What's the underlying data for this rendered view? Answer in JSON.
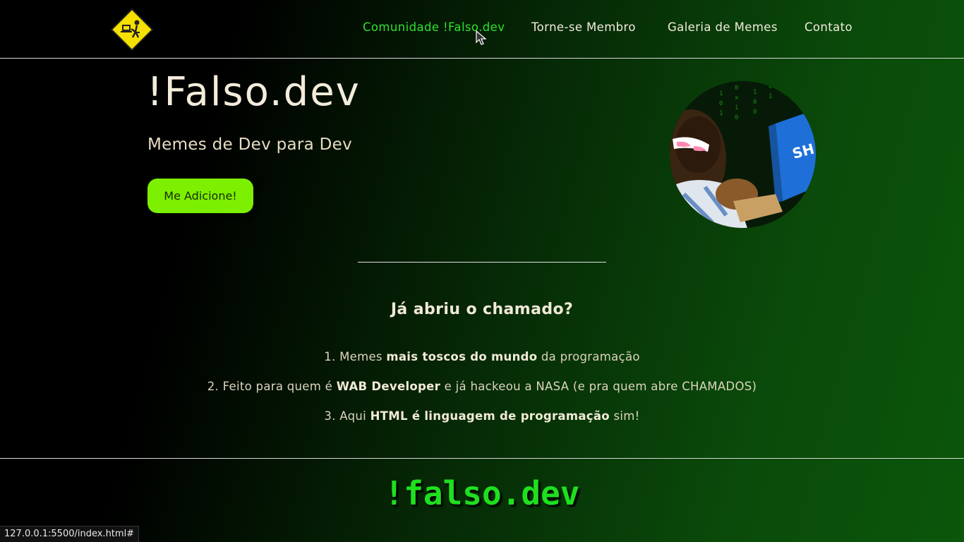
{
  "nav": {
    "logo_icon": "dev-at-computer-warning-sign-icon",
    "links": [
      {
        "label": "Comunidade !Falso.dev",
        "active": true
      },
      {
        "label": "Torne-se Membro",
        "active": false
      },
      {
        "label": "Galeria de Memes",
        "active": false
      },
      {
        "label": "Contato",
        "active": false
      }
    ]
  },
  "hero": {
    "title": "!Falso.dev",
    "subtitle": "Memes de Dev para Dev",
    "cta_label": "Me Adicione!",
    "image_icon": "hacker-typing-meme-icon"
  },
  "section": {
    "title": "Já abriu o chamado?",
    "features": [
      {
        "prefix": "1. Memes ",
        "bold": "mais toscos do mundo",
        "suffix": " da programação"
      },
      {
        "prefix": "2. Feito para quem é ",
        "bold": "WAB Developer",
        "suffix": " e já hackeou a NASA (e pra quem abre CHAMADOS)"
      },
      {
        "prefix": "3. Aqui ",
        "bold": "HTML é linguagem de programação",
        "suffix": " sim!"
      }
    ]
  },
  "footer": {
    "logo_text": "!falso.dev"
  },
  "statusbar": {
    "url": "127.0.0.1:5500/index.html#"
  },
  "colors": {
    "accent_green": "#2fe02f",
    "cta_green": "#7cf000",
    "footer_green": "#1fe01f"
  }
}
